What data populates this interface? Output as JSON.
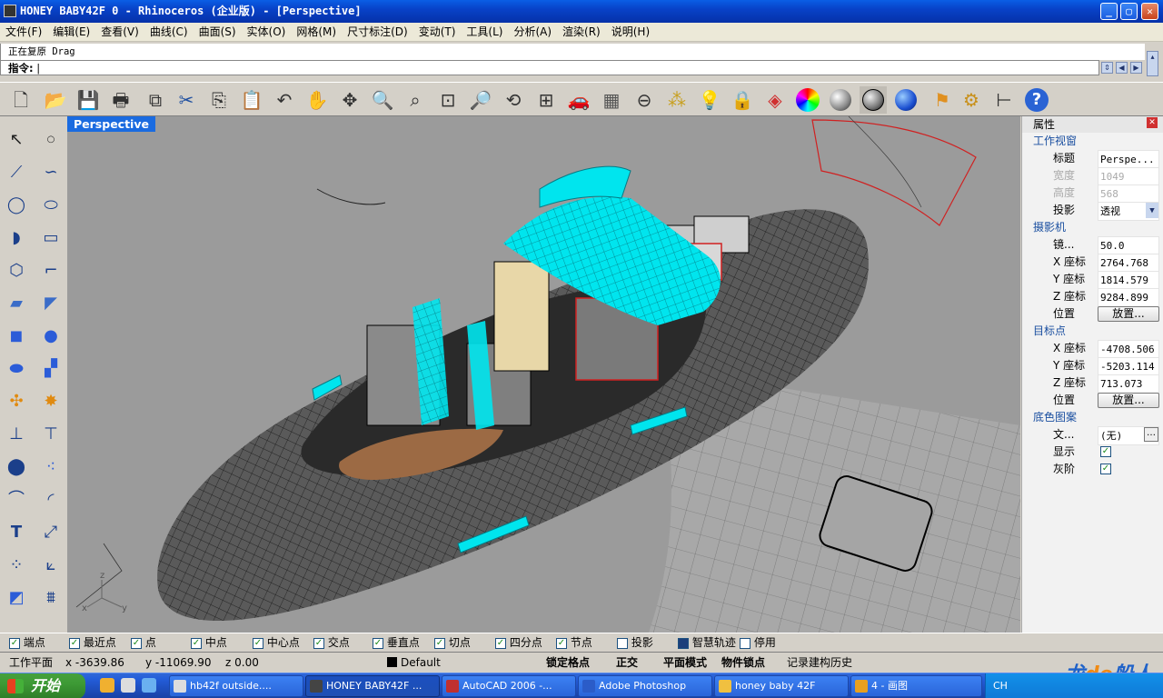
{
  "window": {
    "title": "HONEY BABY42F 0 - Rhinoceros (企业版) - [Perspective]"
  },
  "menu": [
    "文件(F)",
    "编辑(E)",
    "查看(V)",
    "曲线(C)",
    "曲面(S)",
    "实体(O)",
    "网格(M)",
    "尺寸标注(D)",
    "变动(T)",
    "工具(L)",
    "分析(A)",
    "渲染(R)",
    "说明(H)"
  ],
  "command": {
    "history": "正在复原 Drag",
    "prompt": "指令:"
  },
  "toolbar_icons": [
    "new-icon",
    "open-icon",
    "save-icon",
    "print-icon",
    "import-icon",
    "cut-icon",
    "copy-icon",
    "paste-icon",
    "undo-icon",
    "pan-icon",
    "rotate-view-icon",
    "zoom-dynamic-icon",
    "zoom-window-icon",
    "zoom-extents-icon",
    "zoom-selected-icon",
    "undo-view-icon",
    "four-viewports-icon",
    "car-icon",
    "grid-icon",
    "snap-icon",
    "points-icon",
    "light-icon",
    "lock-icon",
    "layer-icon",
    "color-wheel-icon",
    "shaded-sphere-icon",
    "wireframe-sphere-icon",
    "render-sphere-icon",
    "flag-icon",
    "gear-icon",
    "dimension-icon",
    "help-icon"
  ],
  "viewport": {
    "label": "Perspective",
    "axes": {
      "x": "x",
      "y": "y",
      "z": "z"
    }
  },
  "properties": {
    "header": "属性",
    "viewport_section": "工作视窗",
    "title_label": "标题",
    "title_value": "Perspe...",
    "width_label": "宽度",
    "width_value": "1049",
    "height_label": "高度",
    "height_value": "568",
    "projection_label": "投影",
    "projection_value": "透视",
    "camera_section": "摄影机",
    "lens_label": "镜...",
    "lens_value": "50.0",
    "cam_x_label": "X 座标",
    "cam_x": "2764.768",
    "cam_y_label": "Y 座标",
    "cam_y": "1814.579",
    "cam_z_label": "Z 座标",
    "cam_z": "9284.899",
    "position_label": "位置",
    "place_button": "放置...",
    "target_section": "目标点",
    "tgt_x_label": "X 座标",
    "tgt_x": "-4708.506",
    "tgt_y_label": "Y 座标",
    "tgt_y": "-5203.114",
    "tgt_z_label": "Z 座标",
    "tgt_z": "713.073",
    "target_position_label": "位置",
    "target_place_button": "放置...",
    "background_section": "底色图案",
    "file_label": "文...",
    "file_value": "(无)",
    "show_label": "显示",
    "gray_label": "灰阶"
  },
  "osnap": [
    {
      "label": "端点",
      "checked": true
    },
    {
      "label": "最近点",
      "checked": true
    },
    {
      "label": "点",
      "checked": true
    },
    {
      "label": "中点",
      "checked": true
    },
    {
      "label": "中心点",
      "checked": true
    },
    {
      "label": "交点",
      "checked": true
    },
    {
      "label": "垂直点",
      "checked": true
    },
    {
      "label": "切点",
      "checked": true
    },
    {
      "label": "四分点",
      "checked": true
    },
    {
      "label": "节点",
      "checked": true
    },
    {
      "label": "投影",
      "checked": false
    },
    {
      "label": "智慧轨迹",
      "checked": false
    },
    {
      "label": "停用",
      "checked": false
    }
  ],
  "status": {
    "plane": "工作平面",
    "x": "x -3639.86",
    "y": "y -11069.90",
    "z": "z 0.00",
    "layer": "Default",
    "grid_snap": "锁定格点",
    "ortho": "正交",
    "planar": "平面模式",
    "osnap": "物件锁点",
    "history": "记录建构历史"
  },
  "taskbar": {
    "start": "开始",
    "tasks": [
      "hb42f outside....",
      "HONEY BABY42F ...",
      "AutoCAD 2006 -...",
      "Adobe Photoshop",
      "honey baby 42F",
      "4 - 画图"
    ],
    "tray_text": "CH"
  },
  "watermark": {
    "part1": "龙",
    "part2": "de",
    "part3": "船人"
  },
  "colors": {
    "accent": "#1a6be0",
    "highlight": "#00e5ee",
    "red": "#e02020"
  }
}
